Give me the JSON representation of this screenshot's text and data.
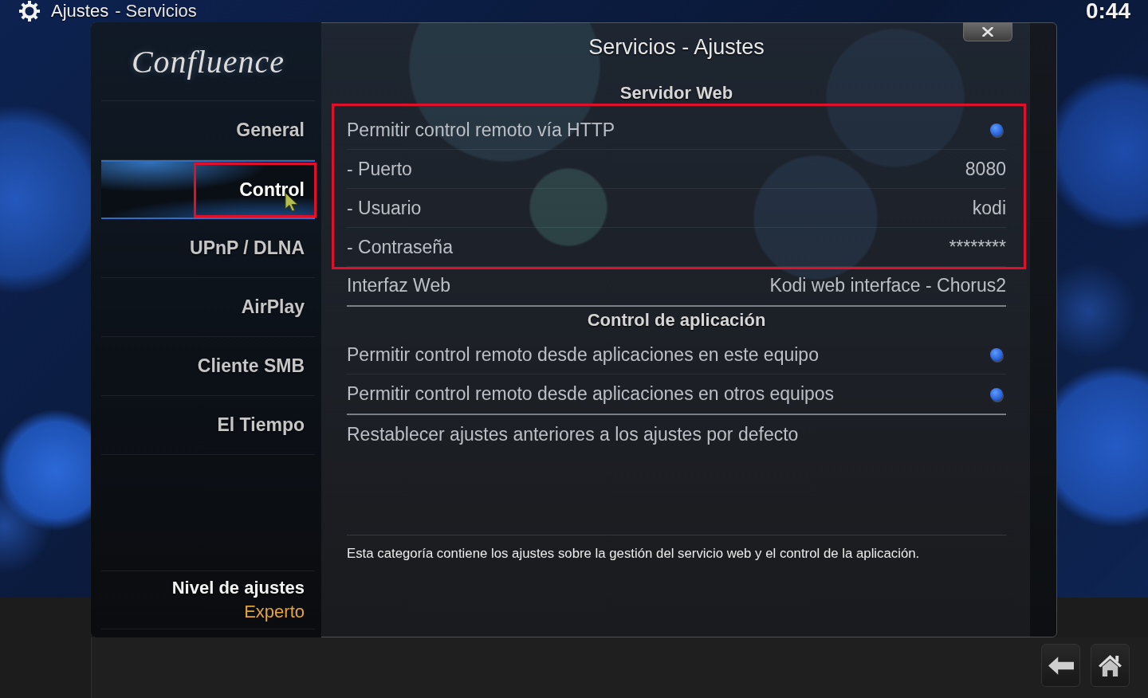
{
  "header": {
    "title": "Ajustes",
    "subtitle": "- Servicios",
    "clock": "0:44"
  },
  "sidebar": {
    "logo": "Confluence",
    "items": [
      {
        "label": "General",
        "selected": false,
        "highlighted": false
      },
      {
        "label": "Control",
        "selected": true,
        "highlighted": true
      },
      {
        "label": "UPnP / DLNA",
        "selected": false,
        "highlighted": false
      },
      {
        "label": "AirPlay",
        "selected": false,
        "highlighted": false
      },
      {
        "label": "Cliente SMB",
        "selected": false,
        "highlighted": false
      },
      {
        "label": "El Tiempo",
        "selected": false,
        "highlighted": false
      }
    ],
    "settings_level": {
      "label": "Nivel de ajustes",
      "value": "Experto"
    }
  },
  "dialog": {
    "title": "Servicios - Ajustes",
    "sections": [
      {
        "title": "Servidor Web",
        "rows": [
          {
            "kind": "toggle",
            "label": "Permitir control remoto vía HTTP",
            "on": true,
            "highlighted": true
          },
          {
            "kind": "value",
            "label": "- Puerto",
            "value": "8080",
            "highlighted": true
          },
          {
            "kind": "value",
            "label": "- Usuario",
            "value": "kodi",
            "highlighted": true
          },
          {
            "kind": "value",
            "label": "- Contraseña",
            "value": "********",
            "highlighted": true
          },
          {
            "kind": "value",
            "label": "Interfaz Web",
            "value": "Kodi web interface - Chorus2",
            "highlighted": false
          }
        ]
      },
      {
        "title": "Control de aplicación",
        "rows": [
          {
            "kind": "toggle",
            "label": "Permitir control remoto desde aplicaciones en este equipo",
            "on": true,
            "highlighted": false
          },
          {
            "kind": "toggle",
            "label": "Permitir control remoto desde aplicaciones en otros equipos",
            "on": true,
            "highlighted": false
          }
        ]
      },
      {
        "rows": [
          {
            "kind": "action",
            "label": "Restablecer ajustes anteriores a los ajustes por defecto",
            "highlighted": false
          }
        ]
      }
    ],
    "description": "Esta categoría contiene los ajustes sobre la gestión del servicio web y el control de la aplicación."
  }
}
